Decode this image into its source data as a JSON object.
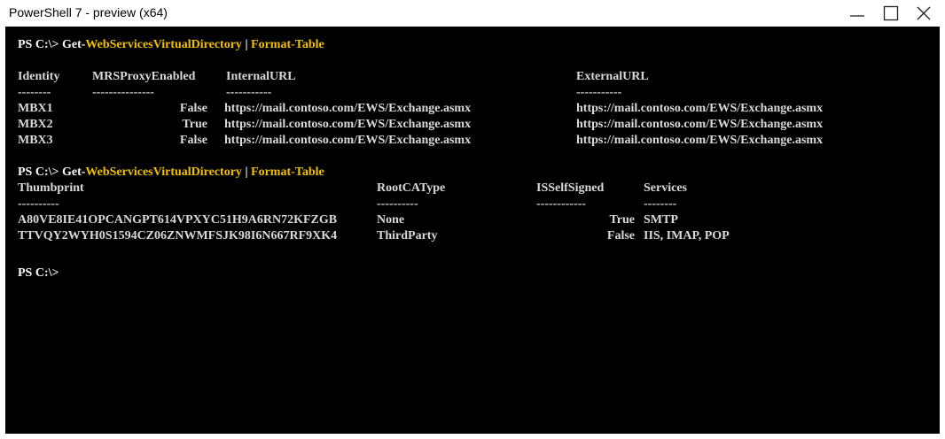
{
  "window": {
    "title": "PowerShell 7 - preview (x64)"
  },
  "terminal": {
    "block1": {
      "prompt": "PS C:\\> ",
      "cmd_prefix": "Get-",
      "cmd_name": "WebServicesVirtualDirectory",
      "pipe": " | ",
      "format": "Format-Table",
      "headers": [
        "Identity",
        "MRSProxyEnabled",
        "InternalURL",
        "ExternalURL"
      ],
      "dashes": [
        "--------",
        "---------------",
        "-----------",
        "-----------"
      ],
      "rows": [
        [
          "MBX1",
          "False",
          "https://mail.contoso.com/EWS/Exchange.asmx",
          "https://mail.contoso.com/EWS/Exchange.asmx"
        ],
        [
          "MBX2",
          "True",
          "https://mail.contoso.com/EWS/Exchange.asmx",
          "https://mail.contoso.com/EWS/Exchange.asmx"
        ],
        [
          "MBX3",
          "False",
          "https://mail.contoso.com/EWS/Exchange.asmx",
          "https://mail.contoso.com/EWS/Exchange.asmx"
        ]
      ]
    },
    "block2": {
      "prompt": "PS C:\\> ",
      "cmd_prefix": "Get-",
      "cmd_name": "WebServicesVirtualDirectory",
      "pipe": " | ",
      "format": "Format-Table",
      "headers": [
        "Thumbprint",
        "RootCAType",
        "ISSelfSigned",
        "Services"
      ],
      "dashes": [
        "----------",
        "----------",
        "------------",
        "--------"
      ],
      "rows": [
        [
          "A80VE8IE41OPCANGPT614VPXYC51H9A6RN72KFZGB",
          "None",
          "True",
          "SMTP"
        ],
        [
          "TTVQY2WYH0S1594CZ06ZNWMFSJK98I6N667RF9XK4",
          "ThirdParty",
          "False",
          "IIS, IMAP, POP"
        ]
      ]
    },
    "final_prompt": "PS C:\\>"
  }
}
